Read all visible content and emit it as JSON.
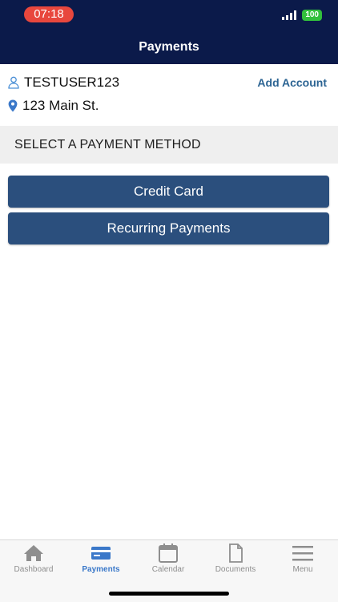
{
  "status_bar": {
    "time": "07:18",
    "battery": "100"
  },
  "header": {
    "title": "Payments"
  },
  "account": {
    "username": "TESTUSER123",
    "add_account_label": "Add Account",
    "address": "123 Main St."
  },
  "section": {
    "label": "SELECT A PAYMENT METHOD"
  },
  "payment_methods": [
    {
      "label": "Credit Card"
    },
    {
      "label": "Recurring Payments"
    }
  ],
  "tabs": [
    {
      "label": "Dashboard",
      "icon": "home-icon",
      "active": false
    },
    {
      "label": "Payments",
      "icon": "credit-card-icon",
      "active": true
    },
    {
      "label": "Calendar",
      "icon": "calendar-icon",
      "active": false
    },
    {
      "label": "Documents",
      "icon": "document-icon",
      "active": false
    },
    {
      "label": "Menu",
      "icon": "menu-icon",
      "active": false
    }
  ],
  "colors": {
    "header_bg": "#0b1a4a",
    "button_bg": "#2b4f7d",
    "accent": "#3a78c9",
    "link": "#2c6493",
    "time_pill": "#e8473d"
  }
}
